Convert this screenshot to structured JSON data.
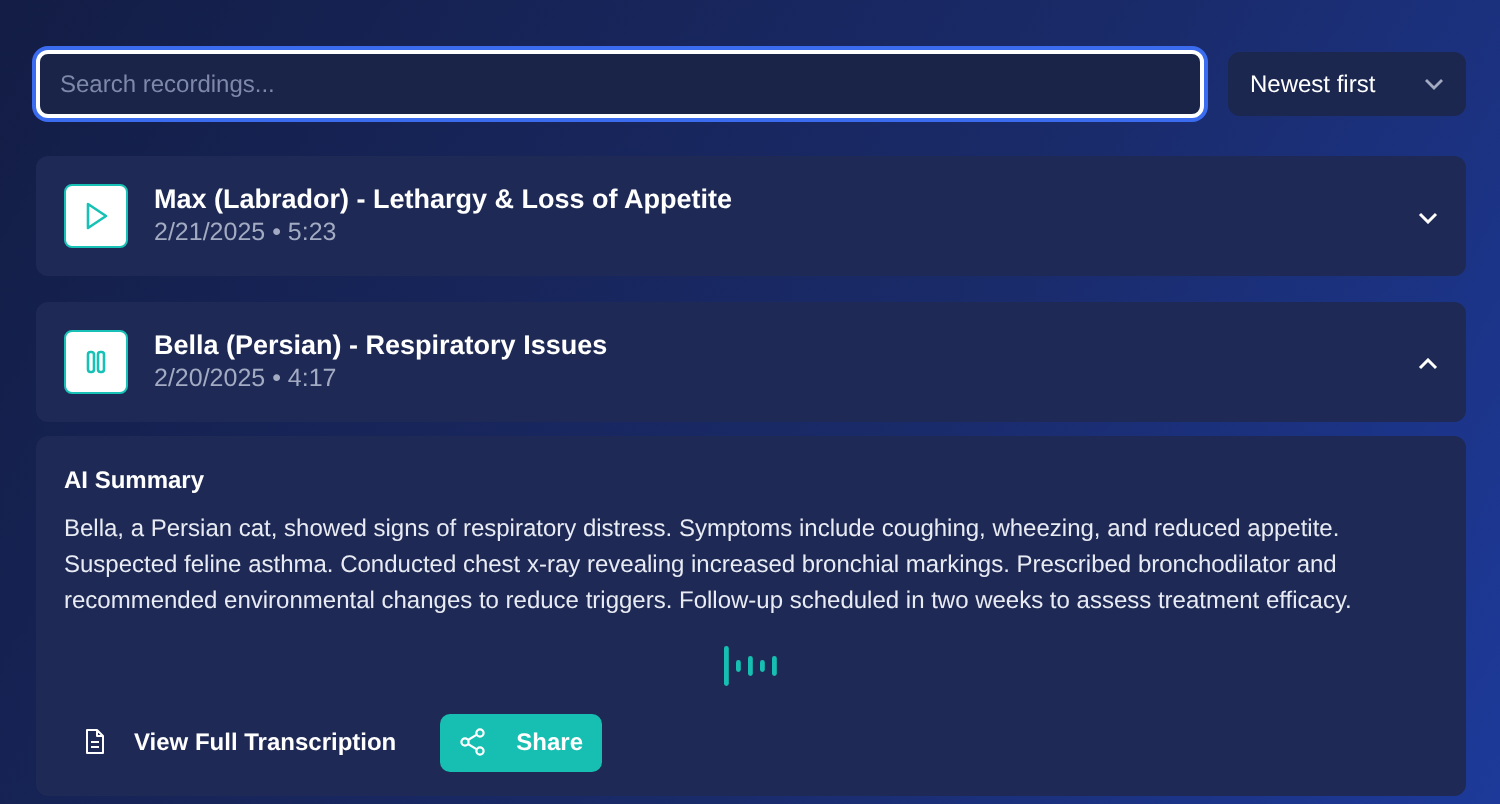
{
  "search": {
    "placeholder": "Search recordings..."
  },
  "sort": {
    "value": "Newest first"
  },
  "recordings": [
    {
      "title": "Max (Labrador) - Lethargy & Loss of Appetite",
      "meta": "2/21/2025 • 5:23",
      "playing": false,
      "expanded": false
    },
    {
      "title": "Bella (Persian) - Respiratory Issues",
      "meta": "2/20/2025 • 4:17",
      "playing": true,
      "expanded": true,
      "summary": {
        "heading": "AI Summary",
        "text": "Bella, a Persian cat, showed signs of respiratory distress. Symptoms include coughing, wheezing, and reduced appetite. Suspected feline asthma. Conducted chest x-ray revealing increased bronchial markings. Prescribed bronchodilator and recommended environmental changes to reduce triggers. Follow-up scheduled in two weeks to assess treatment efficacy.",
        "actions": [
          {
            "label": "View Full Transcription",
            "kind": "link"
          },
          {
            "label": "Share",
            "kind": "primary"
          }
        ]
      }
    }
  ]
}
